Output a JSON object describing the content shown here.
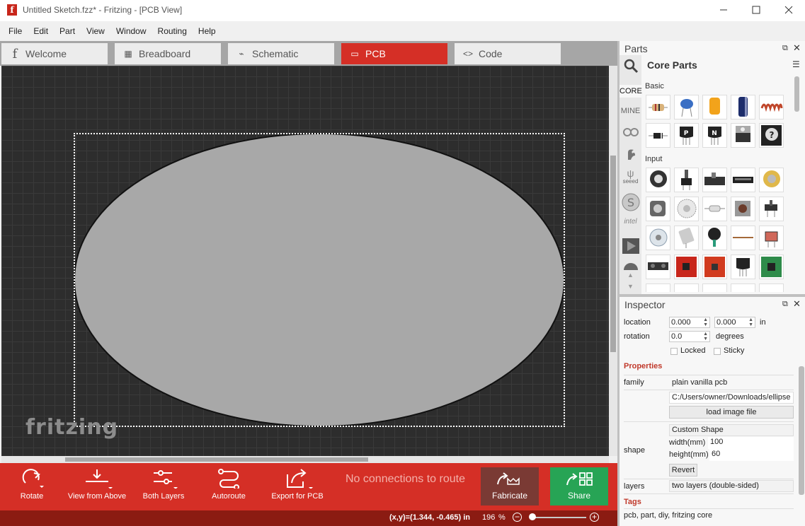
{
  "window": {
    "title": "Untitled Sketch.fzz* - Fritzing - [PCB View]",
    "minimize_icon": "minimize-icon",
    "maximize_icon": "maximize-icon",
    "close_icon": "close-icon"
  },
  "menu": [
    "File",
    "Edit",
    "Part",
    "View",
    "Window",
    "Routing",
    "Help"
  ],
  "tabs": [
    {
      "label": "Welcome",
      "icon": "f"
    },
    {
      "label": "Breadboard",
      "icon": "▦"
    },
    {
      "label": "Schematic",
      "icon": "⌁"
    },
    {
      "label": "PCB",
      "icon": "▭"
    },
    {
      "label": "Code",
      "icon": "<>"
    }
  ],
  "canvas": {
    "watermark": "fritzing"
  },
  "toolbar": {
    "rotate": "Rotate",
    "view_from_above": "View from Above",
    "both_layers": "Both Layers",
    "autoroute": "Autoroute",
    "export_pcb": "Export for PCB",
    "status": "No connections to route",
    "fabricate": "Fabricate",
    "share": "Share"
  },
  "statusbar": {
    "coords": "(x,y)=(1.344, -0.465) in",
    "zoom": "196",
    "zoom_unit": "%",
    "zoom_level": 0.05
  },
  "parts": {
    "title": "Parts",
    "bin_title": "Core Parts",
    "bins": [
      "CORE",
      "MINE",
      "seeed",
      "intel"
    ],
    "sections": {
      "basic": "Basic",
      "input": "Input"
    }
  },
  "inspector": {
    "title": "Inspector",
    "location_label": "location",
    "loc_x": "0.000",
    "loc_y": "0.000",
    "loc_unit": "in",
    "rotation_label": "rotation",
    "rotation": "0.0",
    "rotation_unit": "degrees",
    "locked": "Locked",
    "sticky": "Sticky",
    "properties": "Properties",
    "family_label": "family",
    "family": "plain vanilla pcb",
    "image_path": "C:/Users/owner/Downloads/ellipse",
    "load_image": "load image file",
    "shape_label": "shape",
    "shape_value": "Custom Shape",
    "width_label": "width(mm)",
    "width": "100",
    "height_label": "height(mm)",
    "height": "60",
    "revert": "Revert",
    "layers_label": "layers",
    "layers": "two layers (double-sided)",
    "tags": "Tags",
    "tags_value": "pcb, part, diy, fritzing core"
  }
}
